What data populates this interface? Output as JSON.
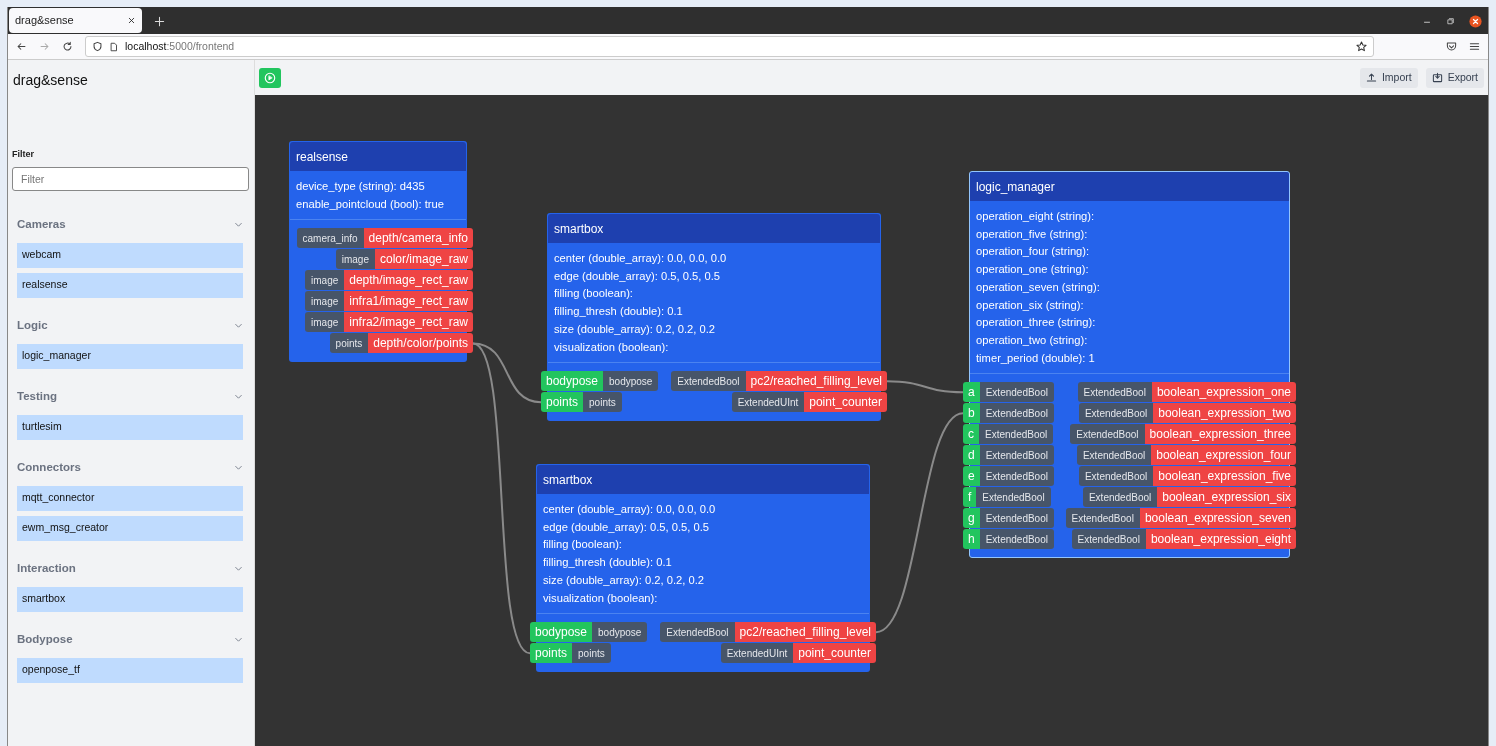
{
  "browser": {
    "tab_title": "drag&sense",
    "url_host": "localhost",
    "url_path": ":5000/frontend"
  },
  "sidebar": {
    "app_title": "drag&sense",
    "filter": {
      "label": "Filter",
      "placeholder": "Filter"
    },
    "groups": [
      {
        "title": "Cameras",
        "expanded": true,
        "items": [
          "webcam",
          "realsense"
        ]
      },
      {
        "title": "Logic",
        "expanded": true,
        "items": [
          "logic_manager"
        ]
      },
      {
        "title": "Testing",
        "expanded": true,
        "items": [
          "turtlesim"
        ]
      },
      {
        "title": "Connectors",
        "expanded": true,
        "items": [
          "mqtt_connector",
          "ewm_msg_creator"
        ]
      },
      {
        "title": "Interaction",
        "expanded": true,
        "items": [
          "smartbox"
        ]
      },
      {
        "title": "Bodypose",
        "expanded": true,
        "items": [
          "openpose_tf"
        ]
      }
    ]
  },
  "toolbar": {
    "buttons": [
      {
        "kind": "import",
        "label": "Import"
      },
      {
        "kind": "export",
        "label": "Export"
      }
    ]
  },
  "nodes": [
    {
      "title": "realsense",
      "selected": false,
      "params": [
        "device_type (string): d435",
        "enable_pointcloud (bool): true"
      ],
      "outputs": [
        {
          "type": "camera_info",
          "name": "depth/camera_info"
        },
        {
          "type": "image",
          "name": "color/image_raw"
        },
        {
          "type": "image",
          "name": "depth/image_rect_raw"
        },
        {
          "type": "image",
          "name": "infra1/image_rect_raw"
        },
        {
          "type": "image",
          "name": "infra2/image_rect_raw"
        },
        {
          "type": "points",
          "name": "depth/color/points"
        }
      ]
    },
    {
      "title": "smartbox",
      "selected": false,
      "params": [
        "center (double_array): 0.0, 0.0, 0.0",
        "edge (double_array): 0.5, 0.5, 0.5",
        "filling (boolean):",
        "filling_thresh (double): 0.1",
        "size (double_array): 0.2, 0.2, 0.2",
        "visualization (boolean):"
      ],
      "inputs": [
        {
          "name": "bodypose",
          "type": "bodypose"
        },
        {
          "name": "points",
          "type": "points"
        }
      ],
      "outputs": [
        {
          "type": "ExtendedBool",
          "name": "pc2/reached_filling_level"
        },
        {
          "type": "ExtendedUInt",
          "name": "point_counter"
        }
      ]
    },
    {
      "title": "smartbox",
      "selected": false,
      "params": [
        "center (double_array): 0.0, 0.0, 0.0",
        "edge (double_array): 0.5, 0.5, 0.5",
        "filling (boolean):",
        "filling_thresh (double): 0.1",
        "size (double_array): 0.2, 0.2, 0.2",
        "visualization (boolean):"
      ],
      "inputs": [
        {
          "name": "bodypose",
          "type": "bodypose"
        },
        {
          "name": "points",
          "type": "points"
        }
      ],
      "outputs": [
        {
          "type": "ExtendedBool",
          "name": "pc2/reached_filling_level"
        },
        {
          "type": "ExtendedUInt",
          "name": "point_counter"
        }
      ]
    },
    {
      "title": "logic_manager",
      "selected": true,
      "params": [
        "operation_eight (string):",
        "operation_five (string):",
        "operation_four (string):",
        "operation_one (string):",
        "operation_seven (string):",
        "operation_six (string):",
        "operation_three (string):",
        "operation_two (string):",
        "timer_period (double): 1"
      ],
      "inputs": [
        {
          "name": "a",
          "type": "ExtendedBool"
        },
        {
          "name": "b",
          "type": "ExtendedBool"
        },
        {
          "name": "c",
          "type": "ExtendedBool"
        },
        {
          "name": "d",
          "type": "ExtendedBool"
        },
        {
          "name": "e",
          "type": "ExtendedBool"
        },
        {
          "name": "f",
          "type": "ExtendedBool"
        },
        {
          "name": "g",
          "type": "ExtendedBool"
        },
        {
          "name": "h",
          "type": "ExtendedBool"
        }
      ],
      "outputs": [
        {
          "type": "ExtendedBool",
          "name": "boolean_expression_one"
        },
        {
          "type": "ExtendedBool",
          "name": "boolean_expression_two"
        },
        {
          "type": "ExtendedBool",
          "name": "boolean_expression_three"
        },
        {
          "type": "ExtendedBool",
          "name": "boolean_expression_four"
        },
        {
          "type": "ExtendedBool",
          "name": "boolean_expression_five"
        },
        {
          "type": "ExtendedBool",
          "name": "boolean_expression_six"
        },
        {
          "type": "ExtendedBool",
          "name": "boolean_expression_seven"
        },
        {
          "type": "ExtendedBool",
          "name": "boolean_expression_eight"
        }
      ]
    }
  ]
}
